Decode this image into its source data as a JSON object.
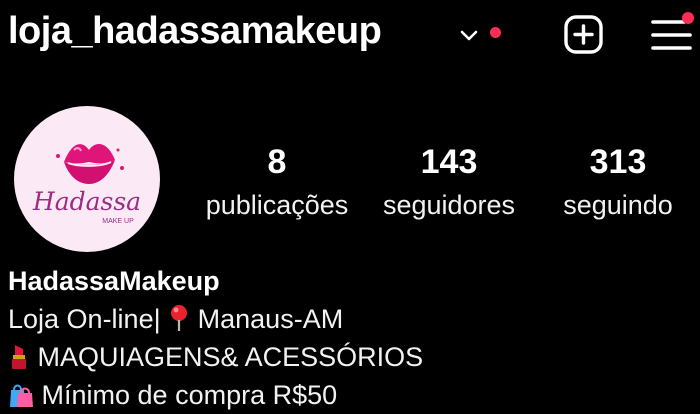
{
  "header": {
    "username": "loja_hadassamakeup",
    "icons": {
      "account_switch": "chevron-down-icon",
      "notification": "notification-dot",
      "new_post": "plus-square-icon",
      "menu": "hamburger-menu-icon"
    },
    "colors": {
      "notification_dot": "#ff2d55",
      "background": "#000000",
      "text": "#ffffff"
    }
  },
  "profile": {
    "avatar": {
      "brand_text": "Hadassa",
      "brand_subtext": "MAKE UP",
      "colors": {
        "background": "#fbe9f5",
        "lips": "#e0157a",
        "text": "#9b2d82"
      }
    },
    "stats": [
      {
        "value": "8",
        "label": "publicações"
      },
      {
        "value": "143",
        "label": "seguidores"
      },
      {
        "value": "313",
        "label": "seguindo"
      }
    ]
  },
  "bio": {
    "name": "HadassaMakeup",
    "line1_text": "Loja On-line|",
    "line1_pin_icon": "round-pushpin-icon",
    "line1_location": "Manaus-AM",
    "line2_icon": "lipstick-icon",
    "line2_text": "MAQUIAGENS& ACESSÓRIOS",
    "line3_icon": "shopping-bags-icon",
    "line3_text": "Mínimo de compra R$50"
  }
}
